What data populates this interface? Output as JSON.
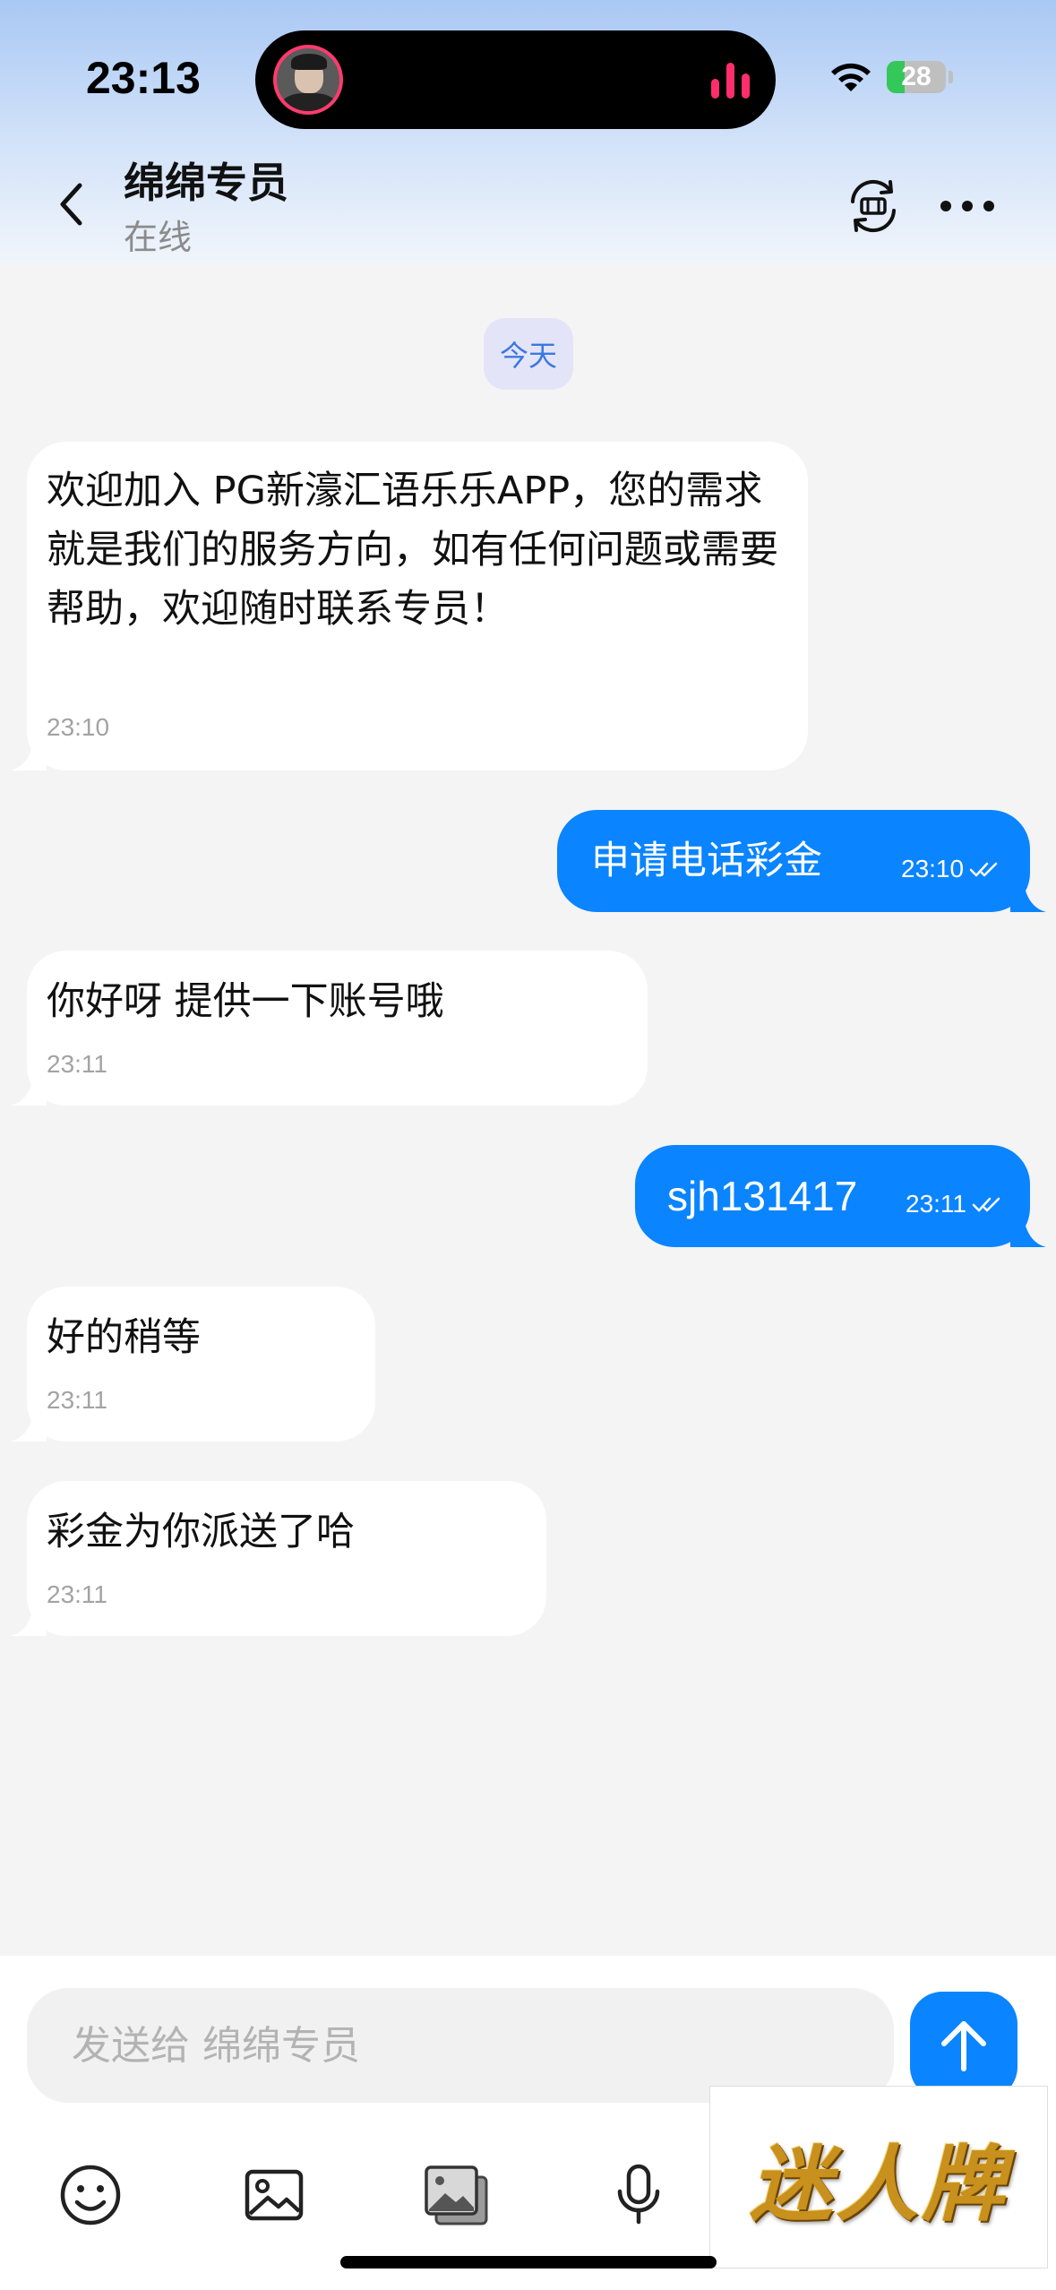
{
  "status_bar": {
    "time": "23:13",
    "battery": "28",
    "icons": [
      "wifi-icon",
      "battery-icon",
      "audio-bars-icon"
    ]
  },
  "header": {
    "title": "绵绵专员",
    "subtitle": "在线",
    "icons": [
      "back-icon",
      "translate-icon",
      "more-icon"
    ]
  },
  "chat": {
    "date_label": "今天",
    "messages": [
      {
        "direction": "in",
        "text": "欢迎加入 PG新濠汇语乐乐APP，您的需求就是我们的服务方向，如有任何问题或需要帮助，欢迎随时联系专员！",
        "time": "23:10"
      },
      {
        "direction": "out",
        "text": "申请电话彩金",
        "time": "23:10",
        "status": "read"
      },
      {
        "direction": "in",
        "text": "你好呀 提供一下账号哦",
        "time": "23:11"
      },
      {
        "direction": "out",
        "text": "sjh131417",
        "time": "23:11",
        "status": "read"
      },
      {
        "direction": "in",
        "text": "好的稍等",
        "time": "23:11"
      },
      {
        "direction": "in",
        "text": "彩金为你派送了哈",
        "time": "23:11"
      }
    ]
  },
  "composer": {
    "placeholder": "发送给 绵绵专员",
    "tools": [
      "emoji-icon",
      "image-icon",
      "gallery-icon",
      "microphone-icon"
    ]
  },
  "watermark": {
    "text": "迷人牌"
  },
  "colors": {
    "outgoing_bubble": "#0a84ff",
    "incoming_bubble": "#ffffff",
    "chat_background": "#f4f4f4",
    "date_pill_bg": "#e4e4f8",
    "date_pill_text": "#3a78e0",
    "island_accent": "#ff2d6c",
    "battery_green": "#34c759"
  }
}
